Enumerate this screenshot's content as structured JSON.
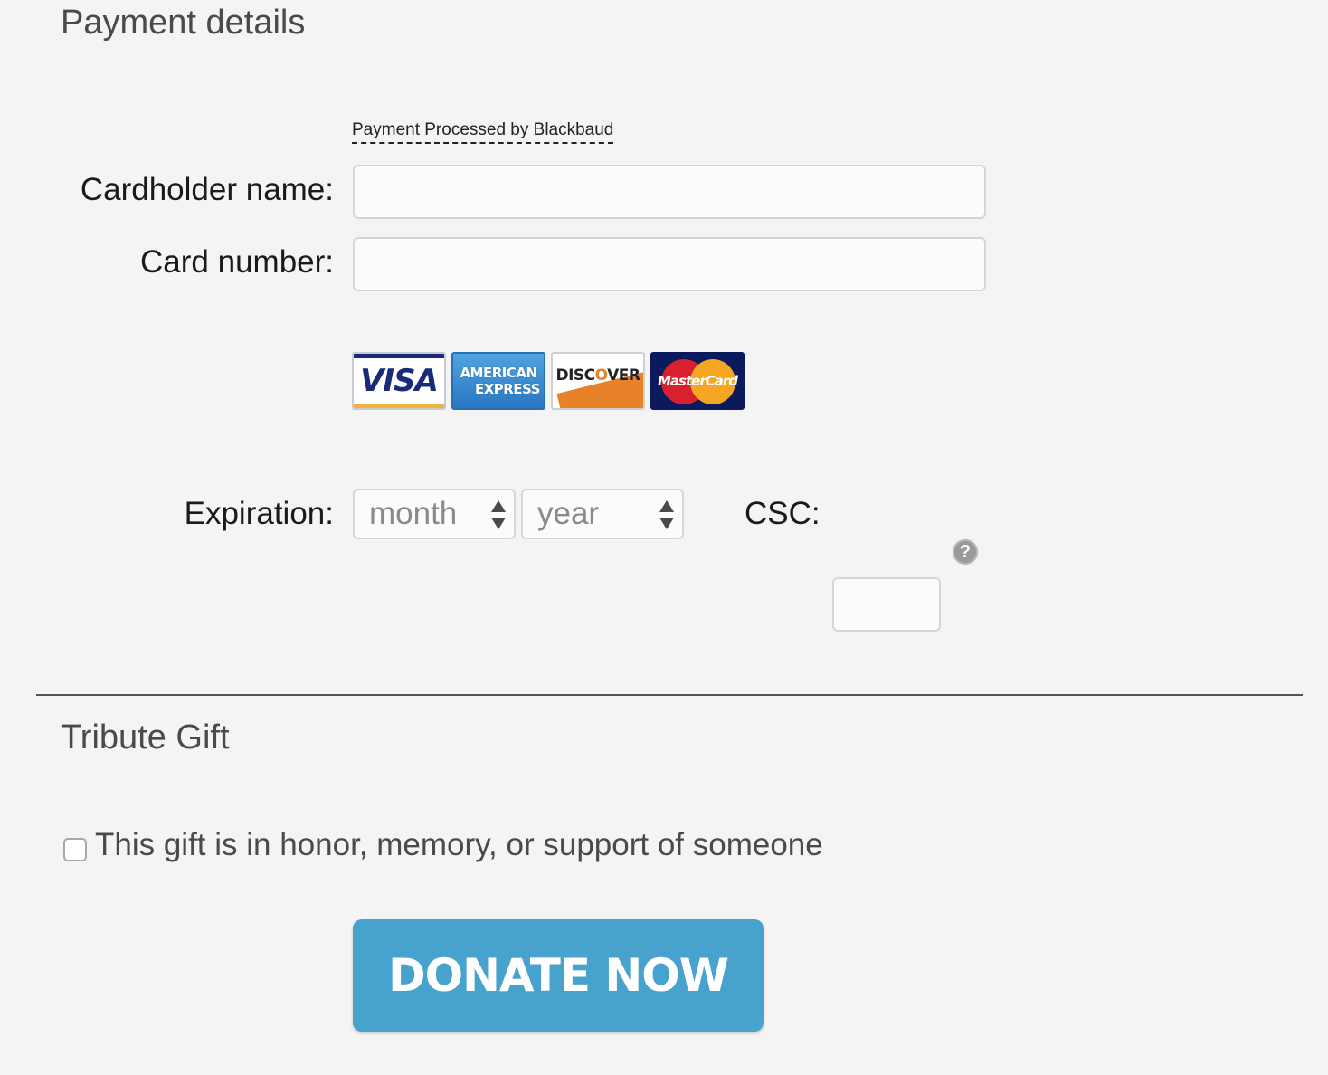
{
  "payment": {
    "title": "Payment details",
    "processed_by": "Payment Processed by Blackbaud",
    "cardholder_label": "Cardholder name:",
    "cardholder_value": "",
    "card_number_label": "Card number:",
    "card_number_value": "",
    "card_logos": [
      {
        "name": "visa",
        "text": "VISA"
      },
      {
        "name": "american-express",
        "line1": "AMERICAN",
        "line2": "EXPRESS"
      },
      {
        "name": "discover",
        "text_a": "DISC",
        "text_o": "O",
        "text_b": "VER"
      },
      {
        "name": "mastercard",
        "text": "MasterCard"
      }
    ],
    "expiration_label": "Expiration:",
    "month_value": "month",
    "year_value": "year",
    "csc_label": "CSC:",
    "csc_help_symbol": "?",
    "csc_value": ""
  },
  "tribute": {
    "title": "Tribute Gift",
    "checkbox_checked": false,
    "checkbox_label": "This gift is in honor, memory, or support of someone"
  },
  "donate_button_label": "DONATE NOW",
  "colors": {
    "background": "#f4f4f4",
    "button": "#47a3cd",
    "divider": "#555555"
  }
}
